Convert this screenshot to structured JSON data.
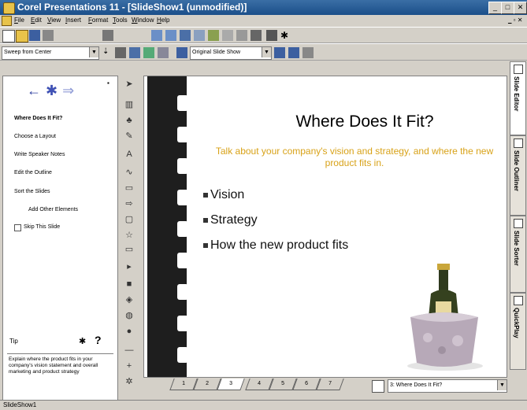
{
  "window": {
    "title": "Corel Presentations 11 - [SlideShow1 (unmodified)]"
  },
  "menu": [
    "File",
    "Edit",
    "View",
    "Insert",
    "Format",
    "Tools",
    "Window",
    "Help"
  ],
  "toolbar": {
    "transition_value": "Sweep from Center",
    "show_value": "Original Slide Show"
  },
  "expert": {
    "tasks": [
      "Where Does It Fit?",
      "Choose a Layout",
      "Write Speaker Notes",
      "Edit the Outline",
      "Sort the Slides",
      "Add Other Elements",
      "Skip This Slide"
    ],
    "tip_label": "Tip",
    "tip_text": "Explain where the product fits in your company's vision statement and overall marketing and product strategy"
  },
  "slide": {
    "title": "Where Does It Fit?",
    "subtitle": "Talk about your company's vision and strategy, and where the new product fits in.",
    "bullets": [
      "Vision",
      "Strategy",
      "How the new product fits"
    ]
  },
  "view_tabs": [
    "Slide Editor",
    "Slide Outliner",
    "Slide Sorter",
    "QuickPlay"
  ],
  "slide_tabs": [
    "1",
    "2",
    "3",
    "4",
    "5",
    "6",
    "7"
  ],
  "slide_selector_value": "3: Where Does It Fit?",
  "status": {
    "doc_tab": "SlideShow1"
  },
  "colors": {
    "subtitle": "#d8a218",
    "titlebar": "#1b4f8a"
  }
}
